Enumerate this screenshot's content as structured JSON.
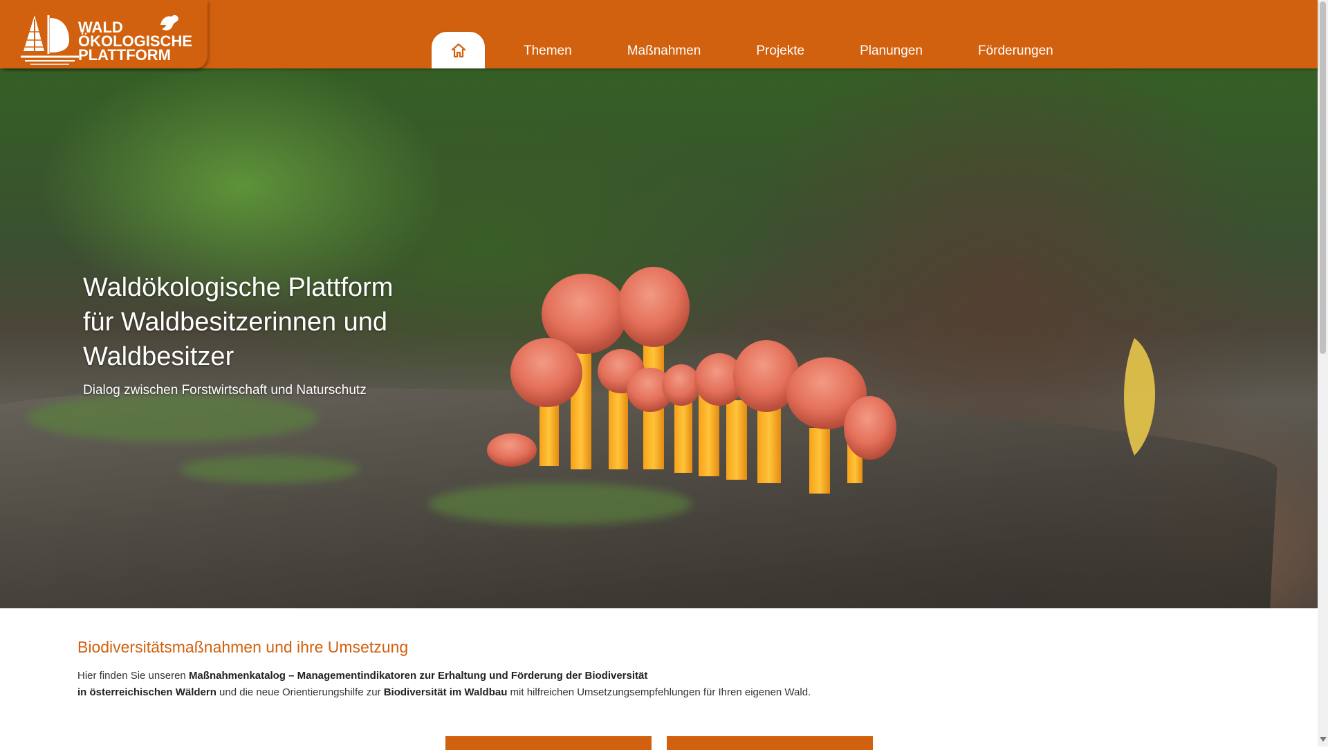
{
  "logo": {
    "line1": "WALD",
    "line2": "ÖKOLOGISCHE",
    "line3": "PLATTFORM"
  },
  "nav": {
    "home_icon": "home-icon",
    "items": [
      {
        "label": "Themen"
      },
      {
        "label": "Maßnahmen"
      },
      {
        "label": "Projekte"
      },
      {
        "label": "Planungen"
      },
      {
        "label": "Förderungen"
      }
    ]
  },
  "hero": {
    "title_lines": [
      "Waldökologische Plattform",
      "für Waldbesitzerinnen und",
      "Waldbesitzer"
    ],
    "subtitle": "Dialog zwischen Forstwirtschaft und Naturschutz"
  },
  "section": {
    "title": "Biodiversitätsmaßnahmen und ihre Umsetzung",
    "intro_1": "Hier finden Sie unseren ",
    "intro_bold_1": "Maßnahmenkatalog – Managementindikatoren zur Erhaltung und Förderung der Biodiversität",
    "intro_bold_2": "in österreichischen Wäldern",
    "intro_2": " und die neue Orientierungshilfe zur ",
    "intro_bold_3": "Biodiversität im Waldbau",
    "intro_3": " mit hilfreichen Umsetzungsempfehlungen für Ihren eigenen Wald."
  },
  "colors": {
    "brand_orange": "#d2610f",
    "white": "#ffffff"
  }
}
